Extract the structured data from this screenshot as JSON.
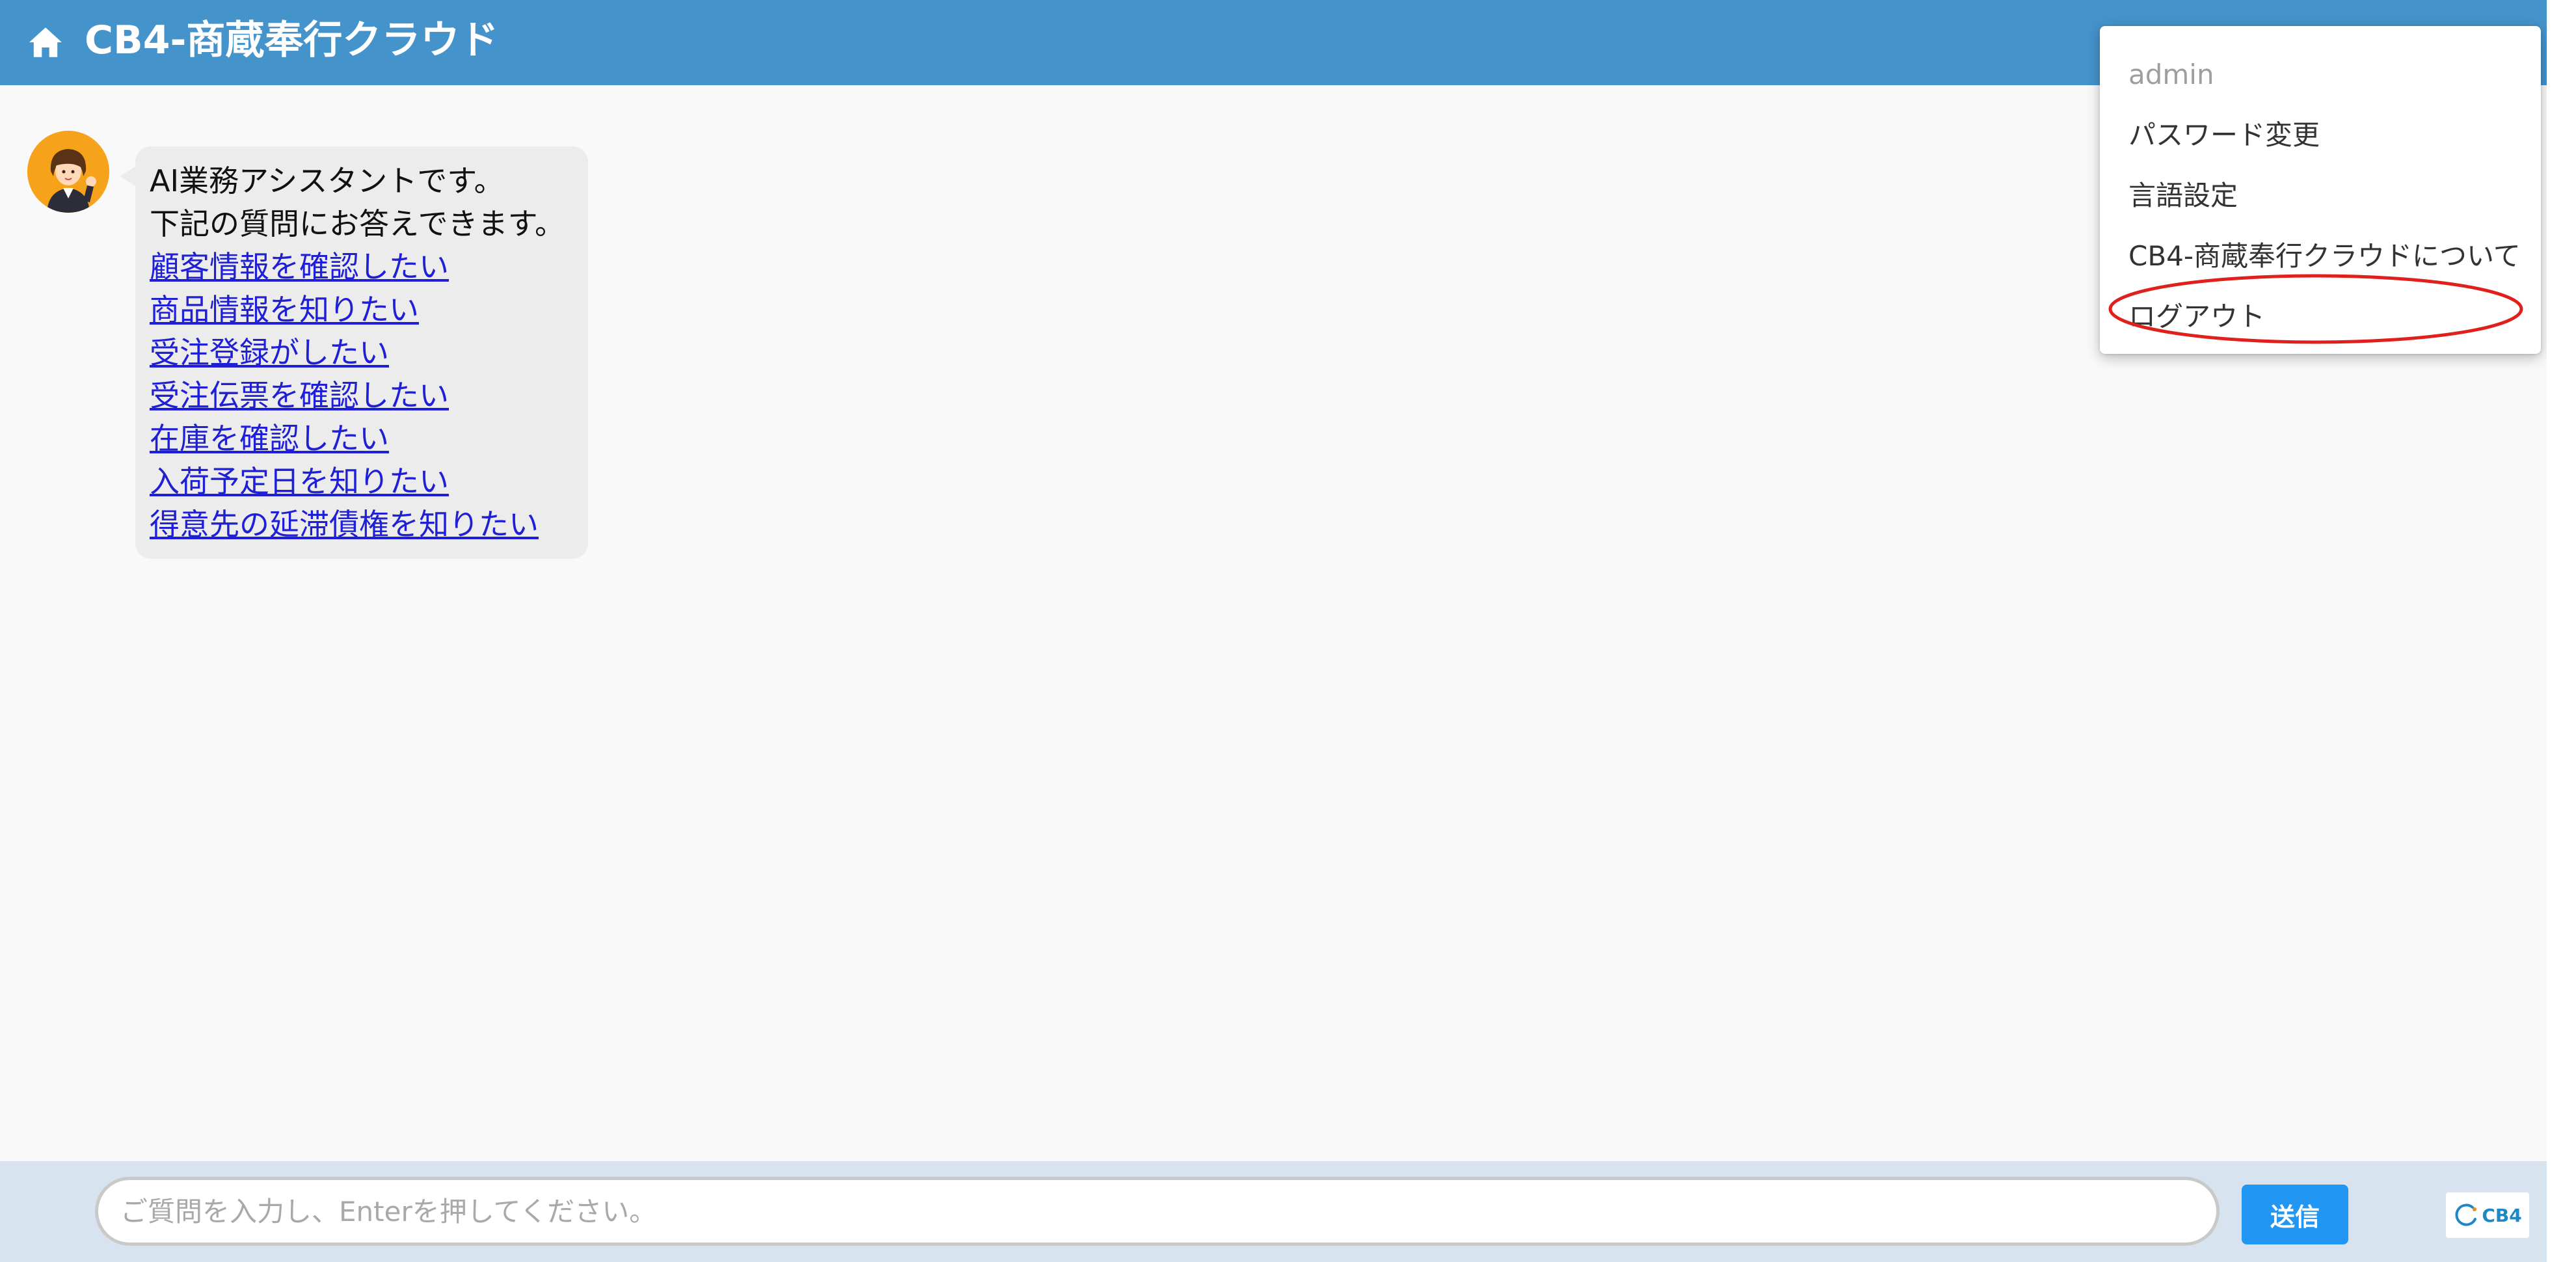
{
  "header": {
    "title": "CB4-商蔵奉行クラウド",
    "home_icon": "home-icon",
    "background_color": "#4593cb"
  },
  "chat": {
    "avatar_icon": "assistant-avatar-icon",
    "intro_lines": [
      "AI業務アシスタントです。",
      "下記の質問にお答えできます。"
    ],
    "links": [
      "顧客情報を確認したい",
      "商品情報を知りたい",
      "受注登録がしたい",
      "受注伝票を確認したい",
      "在庫を確認したい",
      "入荷予定日を知りたい",
      "得意先の延滞債権を知りたい"
    ]
  },
  "user_menu": {
    "username": "admin",
    "items": [
      "パスワード変更",
      "言語設定",
      "CB4-商蔵奉行クラウドについて",
      "ログアウト"
    ],
    "highlight_color": "#e0201d"
  },
  "footer": {
    "input_placeholder": "ご質問を入力し、Enterを押してください。",
    "input_value": "",
    "send_label": "送信",
    "send_color": "#2196f3",
    "logo_text": "CB4"
  }
}
